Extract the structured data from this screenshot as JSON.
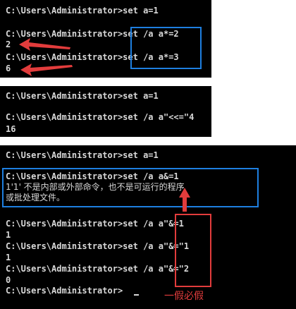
{
  "panels": [
    {
      "lines": [
        "C:\\Users\\Administrator>set a=1",
        "C:\\Users\\Administrator>set /a a*=2",
        "2",
        "C:\\Users\\Administrator>set /a a*=3",
        "6"
      ]
    },
    {
      "lines": [
        "C:\\Users\\Administrator>set a=1",
        "C:\\Users\\Administrator>set /a a\"<<=\"4",
        "16"
      ]
    },
    {
      "lines": [
        "C:\\Users\\Administrator>set a=1",
        "C:\\Users\\Administrator>set /a a&=1",
        "1'1' 不是内部或外部命令，也不是可运行的程序",
        "或批处理文件。",
        "C:\\Users\\Administrator>set /a a\"&=1",
        "1",
        "C:\\Users\\Administrator>set /a a\"&=\"1",
        "1",
        "C:\\Users\\Administrator>set /a a\"&=\"2",
        "0",
        "C:\\Users\\Administrator>"
      ]
    }
  ],
  "annotation": "一假必假",
  "colors": {
    "terminal_bg": "#000000",
    "terminal_text": "#d8d8d8",
    "highlight_blue": "#1e7fe0",
    "highlight_red": "#e23c3c"
  }
}
